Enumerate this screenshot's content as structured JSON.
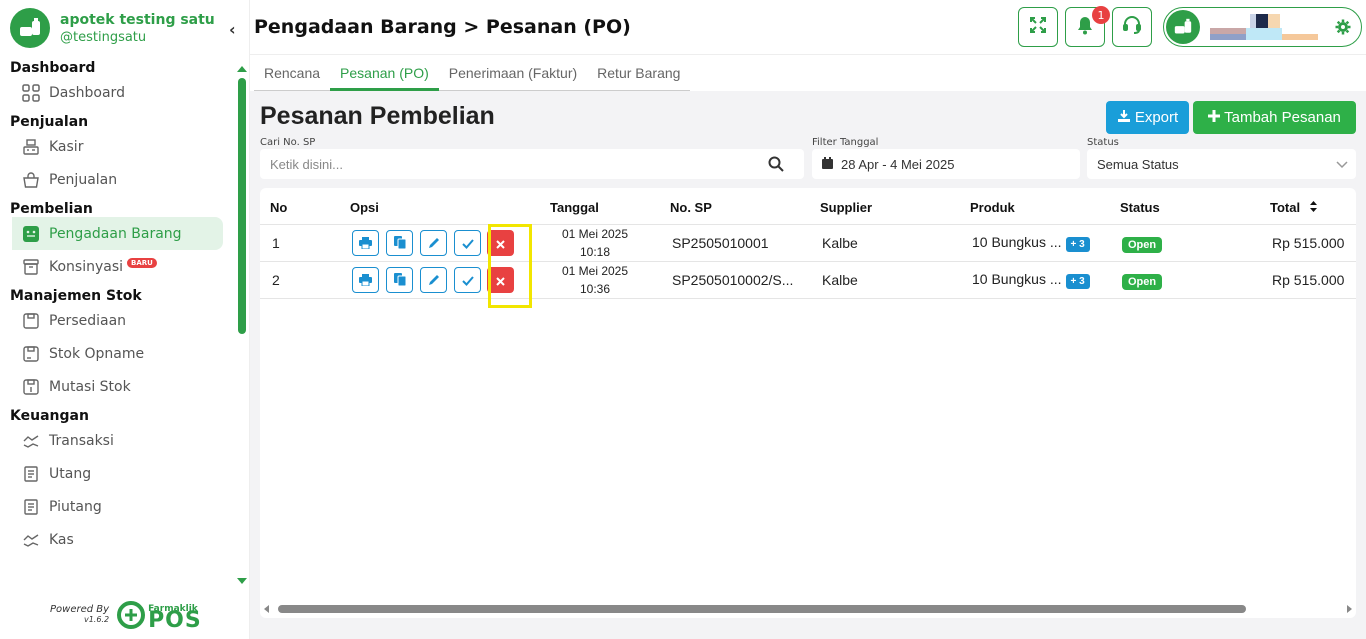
{
  "brand": {
    "name": "apotek testing satu",
    "username": "@testingsatu"
  },
  "sidebar": {
    "sections": [
      {
        "title": "Dashboard",
        "items": [
          {
            "label": "Dashboard",
            "icon": "grid-icon"
          }
        ]
      },
      {
        "title": "Penjualan",
        "items": [
          {
            "label": "Kasir",
            "icon": "cash-register-icon"
          },
          {
            "label": "Penjualan",
            "icon": "basket-icon"
          }
        ]
      },
      {
        "title": "Pembelian",
        "items": [
          {
            "label": "Pengadaan Barang",
            "icon": "procurement-icon",
            "active": true
          },
          {
            "label": "Konsinyasi",
            "icon": "box-icon",
            "badge": "BARU"
          }
        ]
      },
      {
        "title": "Manajemen Stok",
        "items": [
          {
            "label": "Persediaan",
            "icon": "inventory-icon"
          },
          {
            "label": "Stok Opname",
            "icon": "stock-opname-icon"
          },
          {
            "label": "Mutasi Stok",
            "icon": "stock-mutation-icon"
          }
        ]
      },
      {
        "title": "Keuangan",
        "items": [
          {
            "label": "Transaksi",
            "icon": "transaction-icon"
          },
          {
            "label": "Utang",
            "icon": "debt-icon"
          },
          {
            "label": "Piutang",
            "icon": "receivable-icon"
          },
          {
            "label": "Kas",
            "icon": "cash-icon"
          }
        ]
      }
    ],
    "powered_by": "Powered By",
    "version": "v1.6.2",
    "footer_brand_top": "Farmaklik",
    "footer_brand_bottom": "POS"
  },
  "header": {
    "title": "Pengadaan Barang > Pesanan (PO)",
    "notification_count": "1"
  },
  "tabs": [
    {
      "label": "Rencana",
      "active": false
    },
    {
      "label": "Pesanan (PO)",
      "active": true
    },
    {
      "label": "Penerimaan (Faktur)",
      "active": false
    },
    {
      "label": "Retur Barang",
      "active": false
    }
  ],
  "page": {
    "title": "Pesanan Pembelian",
    "export_label": "Export",
    "add_label": "Tambah Pesanan"
  },
  "filters": {
    "search_label": "Cari No. SP",
    "search_placeholder": "Ketik disini...",
    "date_label": "Filter Tanggal",
    "date_value": "28 Apr - 4 Mei 2025",
    "status_label": "Status",
    "status_value": "Semua Status"
  },
  "table": {
    "headers": {
      "no": "No",
      "opsi": "Opsi",
      "tanggal": "Tanggal",
      "no_sp": "No. SP",
      "supplier": "Supplier",
      "produk": "Produk",
      "status": "Status",
      "total": "Total"
    },
    "rows": [
      {
        "no": "1",
        "date": "01 Mei 2025",
        "time": "10:18",
        "no_sp": "SP2505010001",
        "supplier": "Kalbe",
        "produk": "10 Bungkus ...",
        "extra": "+ 3",
        "status": "Open",
        "total": "Rp 515.000"
      },
      {
        "no": "2",
        "date": "01 Mei 2025",
        "time": "10:36",
        "no_sp": "SP2505010002/S...",
        "supplier": "Kalbe",
        "produk": "10 Bungkus ...",
        "extra": "+ 3",
        "status": "Open",
        "total": "Rp 515.000"
      }
    ]
  },
  "colors": {
    "primary": "#2e9e48",
    "accent_blue": "#1a9ed9",
    "danger": "#e84141",
    "highlight": "#f2e600"
  }
}
